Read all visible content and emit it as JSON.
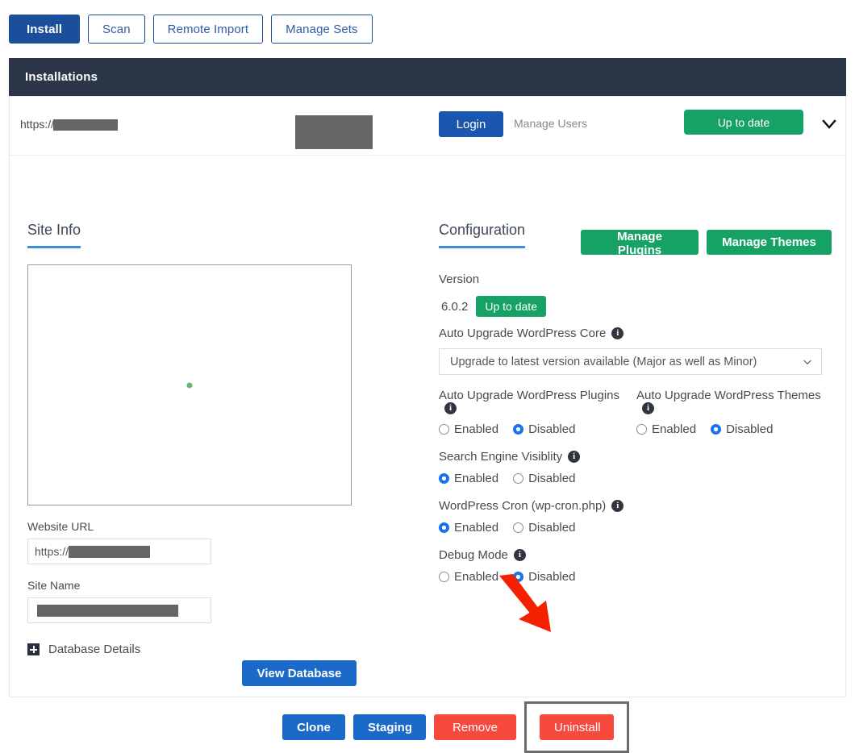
{
  "tabs": [
    {
      "label": "Install",
      "active": true
    },
    {
      "label": "Scan",
      "active": false
    },
    {
      "label": "Remote Import",
      "active": false
    },
    {
      "label": "Manage Sets",
      "active": false
    }
  ],
  "section": {
    "title": "Installations"
  },
  "install_row": {
    "url_prefix": "https://",
    "url_redacted": true,
    "login_label": "Login",
    "manage_users_label": "Manage Users",
    "status_label": "Up to date",
    "collapse_icon": "chevron-down-icon"
  },
  "site_info": {
    "title": "Site Info",
    "preview_state": "loading",
    "website_url_label": "Website URL",
    "website_url_value": "https://",
    "site_name_label": "Site Name",
    "site_name_value": "",
    "database_details_label": "Database Details",
    "database_details_icon": "plus-square-icon",
    "view_database_label": "View Database"
  },
  "configuration": {
    "title": "Configuration",
    "manage_plugins_label": "Manage Plugins",
    "manage_themes_label": "Manage Themes",
    "version_label": "Version",
    "version_number": "6.0.2",
    "version_status": "Up to date",
    "auto_upgrade_core": {
      "label": "Auto Upgrade WordPress Core",
      "info_icon": "info-icon",
      "selected_option": "Upgrade to latest version available (Major as well as Minor)"
    },
    "auto_upgrade_plugins": {
      "label": "Auto Upgrade WordPress Plugins",
      "info_icon": "info-icon",
      "options": [
        "Enabled",
        "Disabled"
      ],
      "selected": "Disabled"
    },
    "auto_upgrade_themes": {
      "label": "Auto Upgrade WordPress Themes",
      "info_icon": "info-icon",
      "options": [
        "Enabled",
        "Disabled"
      ],
      "selected": "Disabled"
    },
    "search_engine_visibility": {
      "label": "Search Engine Visiblity",
      "info_icon": "info-icon",
      "options": [
        "Enabled",
        "Disabled"
      ],
      "selected": "Enabled"
    },
    "wordpress_cron": {
      "label": "WordPress Cron (wp-cron.php)",
      "info_icon": "info-icon",
      "options": [
        "Enabled",
        "Disabled"
      ],
      "selected": "Enabled"
    },
    "debug_mode": {
      "label": "Debug Mode",
      "info_icon": "info-icon",
      "options": [
        "Enabled",
        "Disabled"
      ],
      "selected": "Disabled"
    }
  },
  "actions": {
    "clone_label": "Clone",
    "staging_label": "Staging",
    "remove_label": "Remove",
    "uninstall_label": "Uninstall"
  },
  "annotation": {
    "arrow_color": "#f52000",
    "highlight_color": "#6b6b6b",
    "target": "uninstall-button"
  },
  "colors": {
    "primary_blue": "#1b4f9c",
    "link_blue": "#1b6ac9",
    "green": "#17a265",
    "red": "#f7493e",
    "dark_header": "#2b3749",
    "radio_blue": "#1a73e8"
  }
}
